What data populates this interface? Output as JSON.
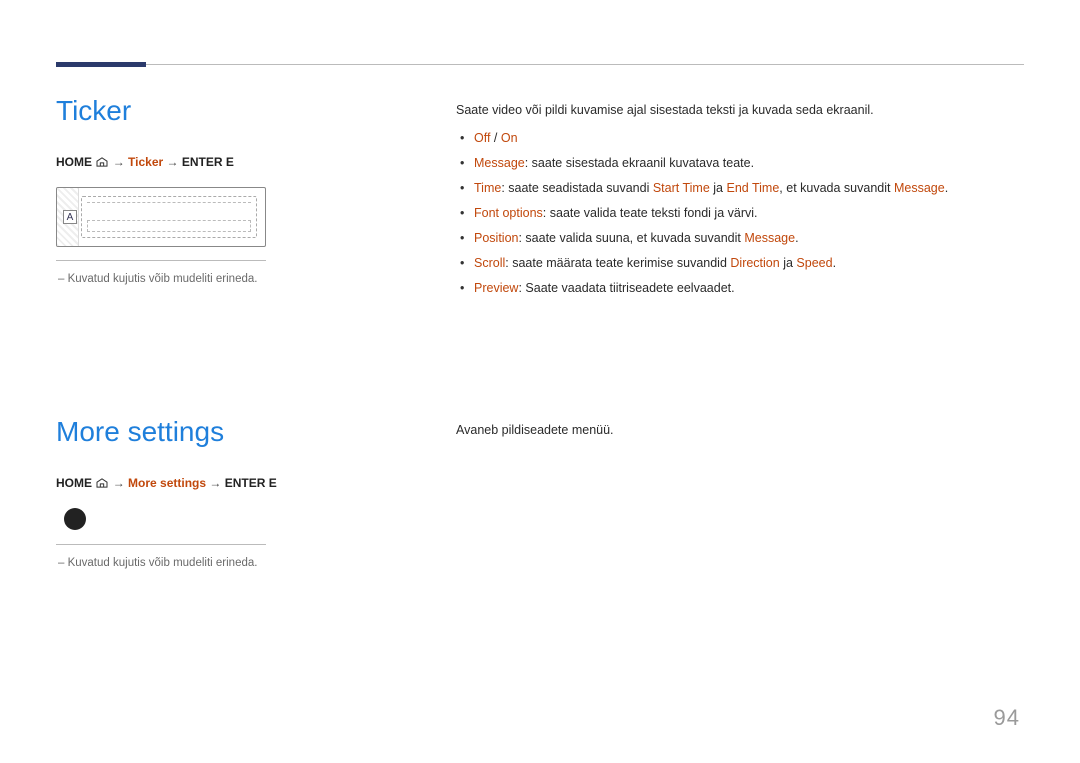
{
  "pageNumber": "94",
  "ticker": {
    "heading": "Ticker",
    "breadcrumb": {
      "home": "HOME",
      "item": "Ticker",
      "enter": "ENTER E"
    },
    "figureLabel": "A",
    "caption": "Kuvatud kujutis võib mudeliti erineda.",
    "intro": "Saate video või pildi kuvamise ajal sisestada teksti ja kuvada seda ekraanil.",
    "bullets": {
      "offOn": {
        "off": "Off",
        "sep": " / ",
        "on": "On"
      },
      "message": {
        "label": "Message",
        "text": ": saate sisestada ekraanil kuvatava teate."
      },
      "time": {
        "label": "Time",
        "pre": ": saate seadistada suvandi ",
        "start": "Start Time",
        "mid": " ja ",
        "end": "End Time",
        "post": ", et kuvada suvandit ",
        "msg": "Message",
        "dot": "."
      },
      "font": {
        "label": "Font options",
        "text": ": saate valida teate teksti fondi ja värvi."
      },
      "position": {
        "label": "Position",
        "pre": ": saate valida suuna, et kuvada suvandit ",
        "msg": "Message",
        "dot": "."
      },
      "scroll": {
        "label": "Scroll",
        "pre": ": saate määrata teate kerimise suvandid ",
        "dir": "Direction",
        "mid": " ja ",
        "spd": "Speed",
        "dot": "."
      },
      "preview": {
        "label": "Preview",
        "text": ": Saate vaadata tiitriseadete eelvaadet."
      }
    }
  },
  "more": {
    "heading": "More settings",
    "breadcrumb": {
      "home": "HOME",
      "item": "More settings",
      "enter": "ENTER E"
    },
    "caption": "Kuvatud kujutis võib mudeliti erineda.",
    "intro": "Avaneb pildiseadete menüü."
  }
}
